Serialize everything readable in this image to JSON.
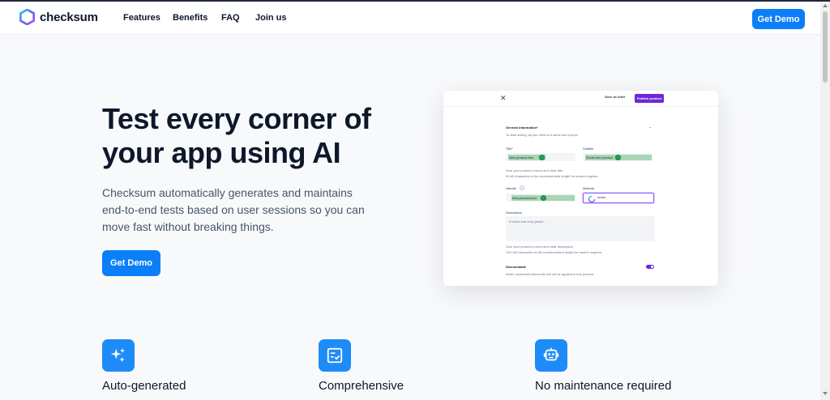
{
  "header": {
    "brand": "checksum",
    "nav": [
      "Features",
      "Benefits",
      "FAQ",
      "Join us"
    ],
    "cta": "Get Demo"
  },
  "hero": {
    "title": "Test every corner of your app using AI",
    "subtitle": "Checksum automatically generates and maintains end-to-end tests based on user sessions so you can move fast without breaking things.",
    "cta": "Get Demo"
  },
  "product_card": {
    "close": "✕",
    "save_draft": "Save as draft",
    "publish": "Publish product",
    "general_info": "General information*",
    "general_info_hint": "To start selling, all you need is a name and a price.",
    "collapse": "–",
    "title_label": "Title*",
    "title_value": "New product test",
    "subtitle_label": "Subtitle",
    "subtitle_value": "Great new product",
    "title_hint_1": "Give your product a short and clear title.",
    "title_hint_2": "50-60 characters is the recommended length for search engines.",
    "handle_label": "Handle",
    "handle_value": "new-product-test",
    "material_label": "Material",
    "material_value": "metal",
    "description_label": "Description",
    "description_placeholder": "A warm and cozy jacket...",
    "desc_hint_1": "Give your product a short and clear description.",
    "desc_hint_2": "120-160 characters is the recommended length for search engines.",
    "discountable_label": "Discountable",
    "discountable_hint": "When unchecked discounts will not be applied to this product."
  },
  "features": [
    {
      "title": "Auto-generated",
      "icon": "sparkles-icon"
    },
    {
      "title": "Comprehensive",
      "icon": "checklist-icon"
    },
    {
      "title": "No maintenance required",
      "icon": "robot-icon"
    }
  ],
  "colors": {
    "accent": "#0b7ff7",
    "publish": "#6d28d9",
    "highlight": "#a8d5b5"
  }
}
